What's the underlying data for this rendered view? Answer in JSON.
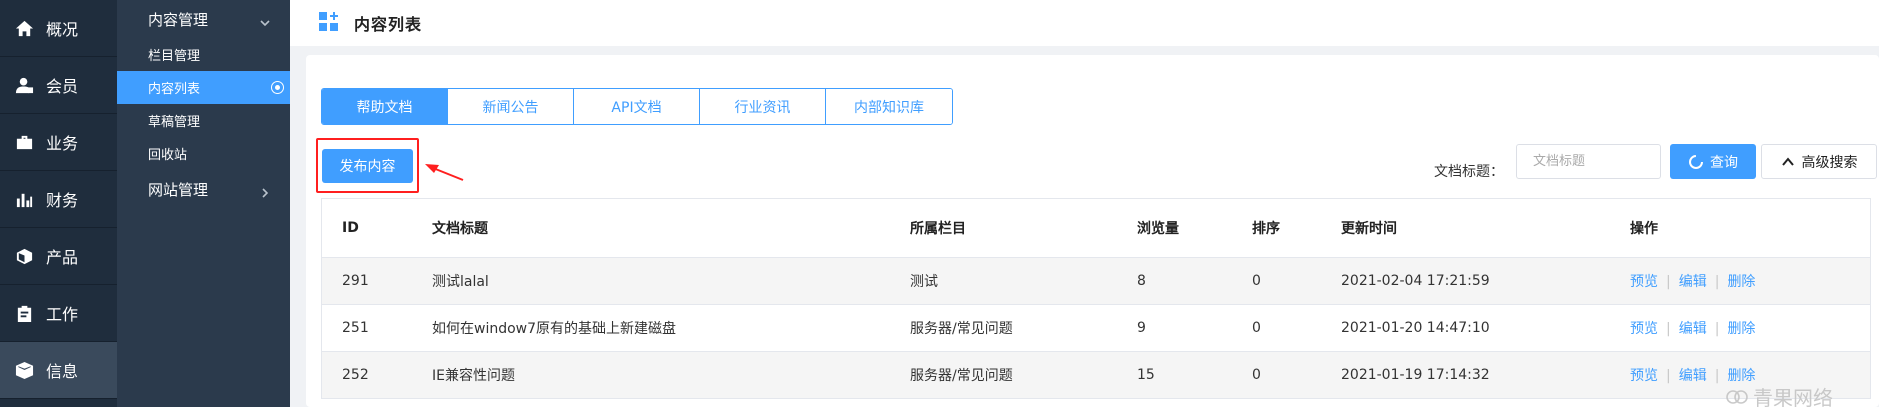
{
  "main_nav": [
    {
      "label": "概况",
      "icon": "home-icon",
      "active": false
    },
    {
      "label": "会员",
      "icon": "user-icon",
      "active": false
    },
    {
      "label": "业务",
      "icon": "briefcase-icon",
      "active": false
    },
    {
      "label": "财务",
      "icon": "bar-chart-icon",
      "active": false
    },
    {
      "label": "产品",
      "icon": "cube-icon",
      "active": false
    },
    {
      "label": "工作",
      "icon": "clipboard-icon",
      "active": false
    },
    {
      "label": "信息",
      "icon": "box-icon",
      "active": true
    }
  ],
  "sub_nav": {
    "group1": "内容管理",
    "items": [
      "栏目管理",
      "内容列表",
      "草稿管理",
      "回收站"
    ],
    "active_index": 1,
    "group2": "网站管理"
  },
  "header": {
    "title": "内容列表",
    "icon": "grid-plus-icon"
  },
  "tabs": [
    {
      "label": "帮助文档",
      "active": true
    },
    {
      "label": "新闻公告",
      "active": false
    },
    {
      "label": "API文档",
      "active": false
    },
    {
      "label": "行业资讯",
      "active": false
    },
    {
      "label": "内部知识库",
      "active": false
    }
  ],
  "toolbar": {
    "publish_label": "发布内容",
    "search_label": "文档标题：",
    "search_placeholder": "文档标题",
    "query_label": "查询",
    "advanced_label": "高级搜索"
  },
  "table": {
    "headers": [
      "ID",
      "文档标题",
      "所属栏目",
      "浏览量",
      "排序",
      "更新时间",
      "操作"
    ],
    "rows": [
      {
        "id": "291",
        "title": "测试lalal",
        "category": "测试",
        "views": "8",
        "sort": "0",
        "updated": "2021-02-04 17:21:59"
      },
      {
        "id": "251",
        "title": "如何在window7原有的基础上新建磁盘",
        "category": "服务器/常见问题",
        "views": "9",
        "sort": "0",
        "updated": "2021-01-20 14:47:10"
      },
      {
        "id": "252",
        "title": "IE兼容性问题",
        "category": "服务器/常见问题",
        "views": "15",
        "sort": "0",
        "updated": "2021-01-19 17:14:32"
      }
    ],
    "ops": {
      "preview": "预览",
      "edit": "编辑",
      "delete": "删除",
      "separator": "|"
    }
  },
  "watermark": "青果网络",
  "colors": {
    "accent": "#409eff",
    "nav_bg": "#1f2d3d",
    "subnav_bg": "#2b3a4c",
    "highlight": "#ff1f1f"
  }
}
